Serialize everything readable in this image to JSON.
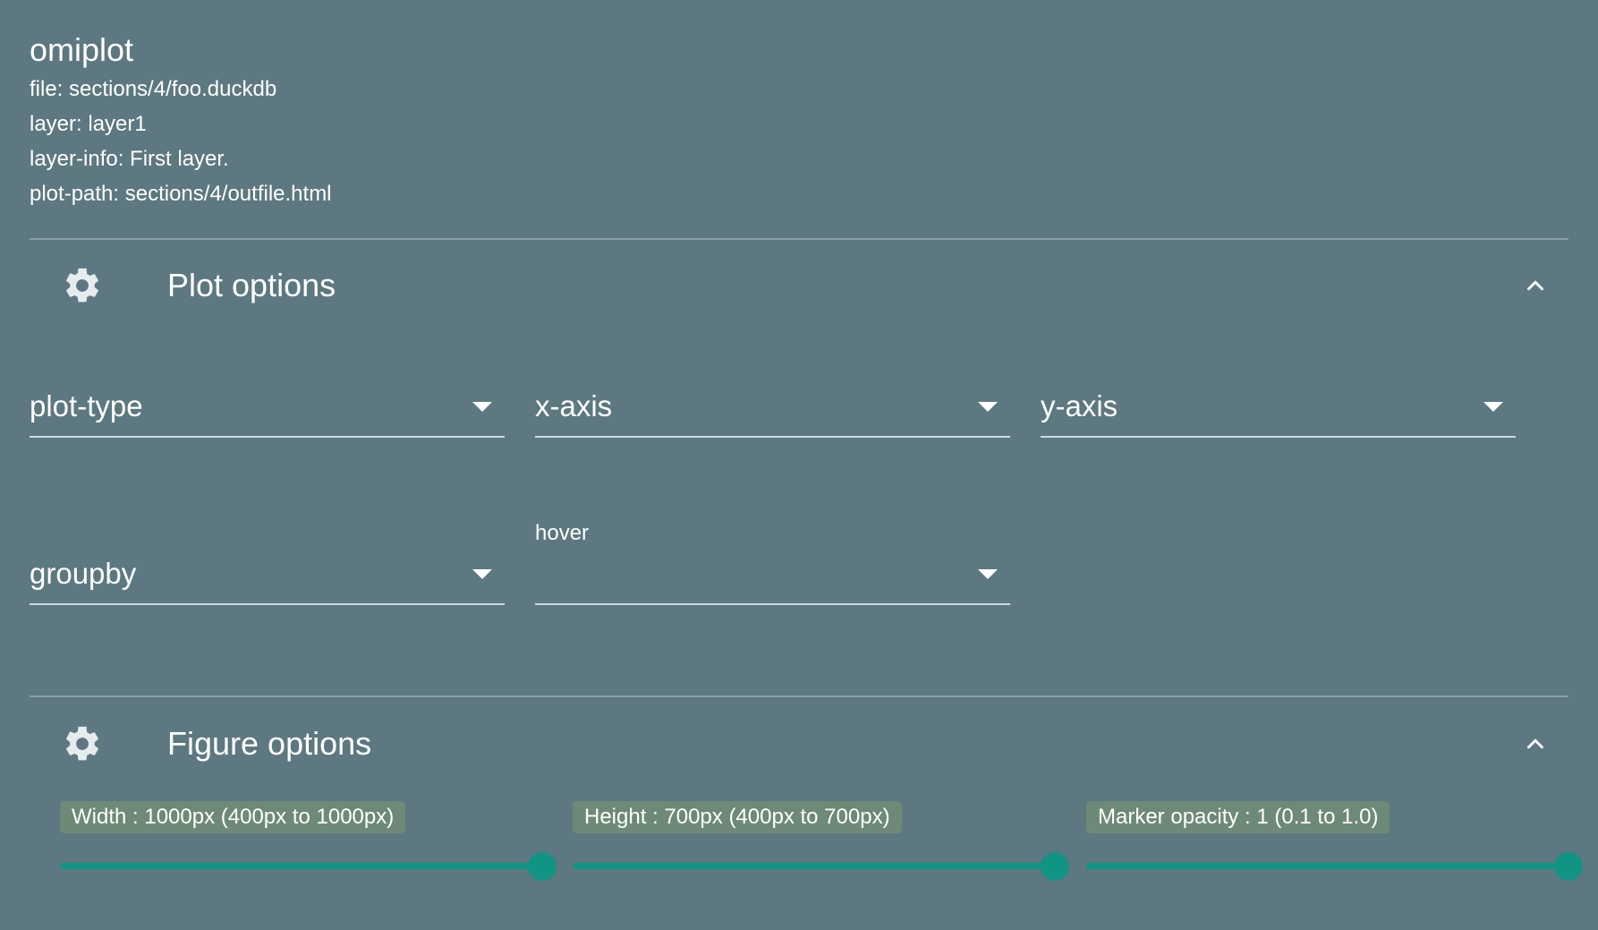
{
  "app": {
    "title": "omiplot"
  },
  "info": [
    "file: sections/4/foo.duckdb",
    "layer: layer1",
    "layer-info: First layer.",
    "plot-path: sections/4/outfile.html"
  ],
  "plot_options": {
    "title": "Plot options",
    "icon": "gear-icon",
    "collapse_icon": "chevron-up-icon",
    "dropdowns": {
      "plot_type": "plot-type",
      "x_axis": "x-axis",
      "y_axis": "y-axis",
      "groupby": "groupby",
      "hover": "hover"
    }
  },
  "figure_options": {
    "title": "Figure options",
    "icon": "gear-icon",
    "collapse_icon": "chevron-up-icon",
    "sliders": [
      {
        "label": "Width : 1000px (400px to 1000px)",
        "value_fraction": 1.0
      },
      {
        "label": "Height : 700px (400px to 700px)",
        "value_fraction": 1.0
      },
      {
        "label": "Marker opacity : 1 (0.1 to 1.0)",
        "value_fraction": 1.0
      }
    ]
  },
  "colors": {
    "background": "#5d7880",
    "accent": "#119483",
    "label_chip": "#6e8a76"
  }
}
